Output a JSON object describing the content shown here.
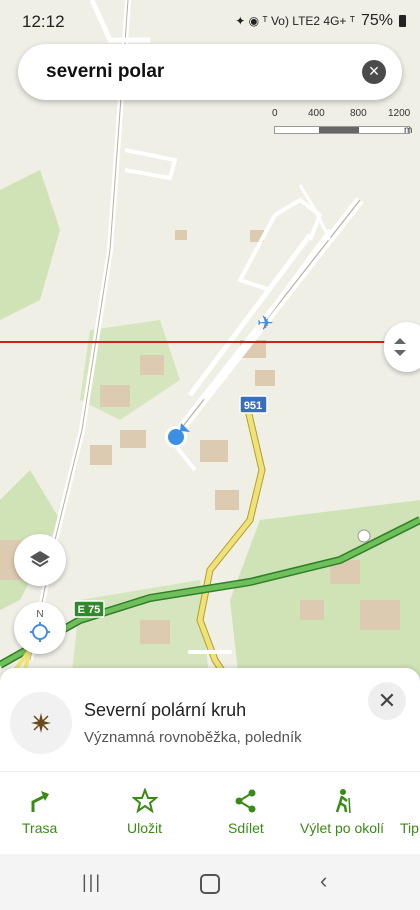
{
  "status": {
    "time": "12:12",
    "icons": "✦ ◉ ᵀ Vo) LTE2 4G+ ᵀ",
    "battery": "75%"
  },
  "search": {
    "query": "severni polar"
  },
  "scale": {
    "ticks": [
      "0",
      "400",
      "800",
      "1200"
    ],
    "unit": "m"
  },
  "map": {
    "road_labels": [
      "951",
      "E 75"
    ],
    "compass": "N"
  },
  "poi": {
    "title": "Severní polární kruh",
    "subtitle": "Významná rovnoběžka, poledník"
  },
  "actions": [
    {
      "label": "Trasa"
    },
    {
      "label": "Uložit"
    },
    {
      "label": "Sdílet"
    },
    {
      "label": "Výlet po okolí"
    },
    {
      "label": "Tip"
    }
  ],
  "colors": {
    "accent": "#3a8a16",
    "arctic_line": "#d21e1e",
    "road_yellow": "#e2d23a",
    "motorway": "#3f9b3a"
  }
}
